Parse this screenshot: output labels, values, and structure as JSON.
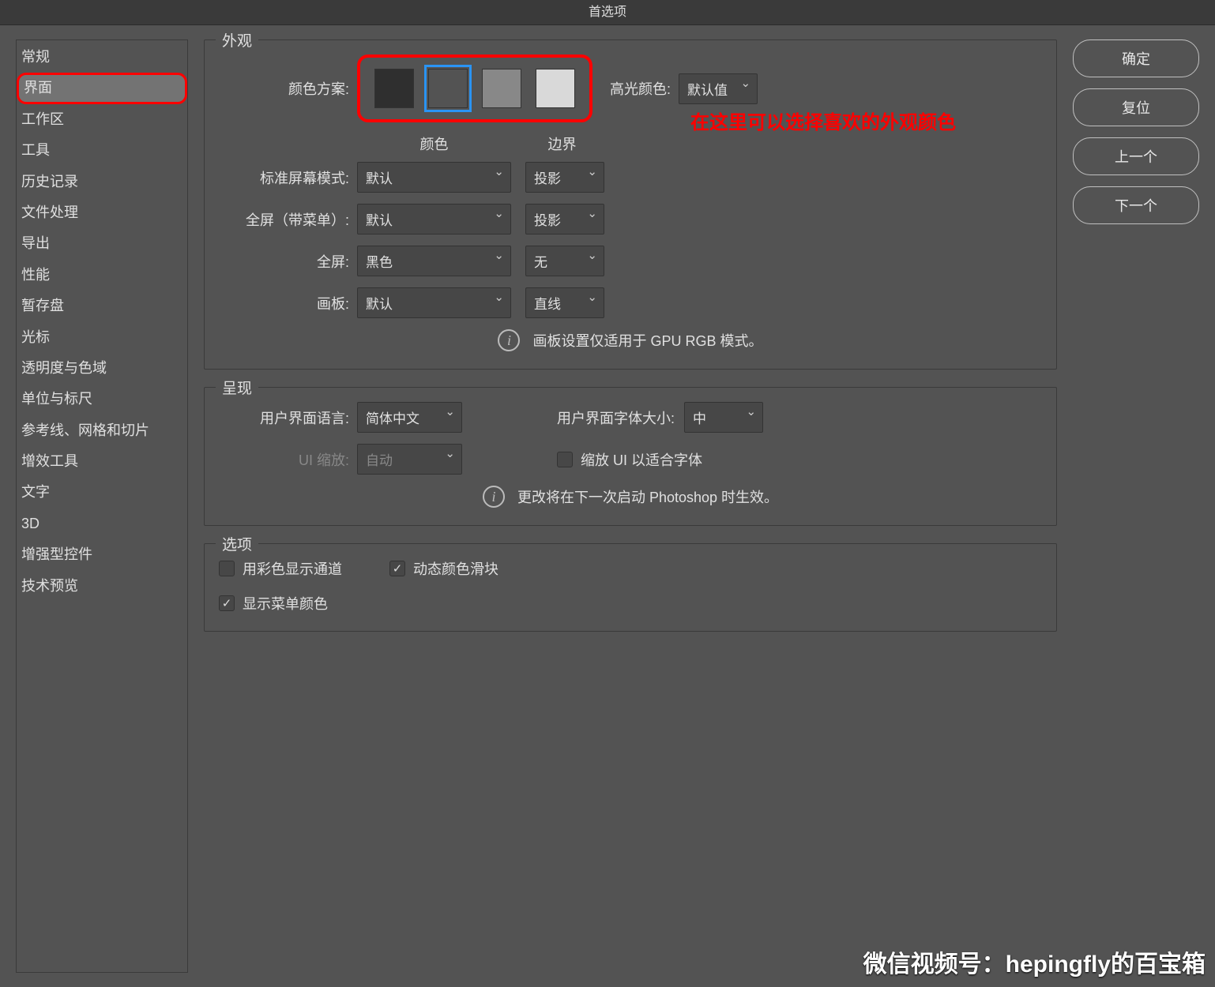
{
  "title": "首选项",
  "sidebar": {
    "items": [
      "常规",
      "界面",
      "工作区",
      "工具",
      "历史记录",
      "文件处理",
      "导出",
      "性能",
      "暂存盘",
      "光标",
      "透明度与色域",
      "单位与标尺",
      "参考线、网格和切片",
      "增效工具",
      "文字",
      "3D",
      "增强型控件",
      "技术预览"
    ],
    "active_index": 1
  },
  "appearance": {
    "legend": "外观",
    "color_scheme_label": "颜色方案:",
    "swatches": [
      "#2f2f2f",
      "#535353",
      "#888888",
      "#d9d9d9"
    ],
    "selected_swatch": 1,
    "highlight_color_label": "高光颜色:",
    "highlight_color_value": "默认值",
    "annotation": "在这里可以选择喜欢的外观颜色",
    "col_color": "颜色",
    "col_border": "边界",
    "rows": [
      {
        "label": "标准屏幕模式:",
        "color": "默认",
        "border": "投影"
      },
      {
        "label": "全屏（带菜单）:",
        "color": "默认",
        "border": "投影"
      },
      {
        "label": "全屏:",
        "color": "黑色",
        "border": "无"
      },
      {
        "label": "画板:",
        "color": "默认",
        "border": "直线"
      }
    ],
    "gpu_note": "画板设置仅适用于 GPU RGB 模式。"
  },
  "presentation": {
    "legend": "呈现",
    "ui_lang_label": "用户界面语言:",
    "ui_lang_value": "简体中文",
    "font_size_label": "用户界面字体大小:",
    "font_size_value": "中",
    "ui_scale_label": "UI 缩放:",
    "ui_scale_value": "自动",
    "scale_fit_label": "缩放 UI 以适合字体",
    "restart_note": "更改将在下一次启动 Photoshop 时生效。"
  },
  "options": {
    "legend": "选项",
    "color_channels": {
      "label": "用彩色显示通道",
      "checked": false
    },
    "dynamic_sliders": {
      "label": "动态颜色滑块",
      "checked": true
    },
    "show_menu_colors": {
      "label": "显示菜单颜色",
      "checked": true
    }
  },
  "buttons": {
    "ok": "确定",
    "reset": "复位",
    "prev": "上一个",
    "next": "下一个"
  },
  "watermark": "微信视频号：hepingfly的百宝箱"
}
